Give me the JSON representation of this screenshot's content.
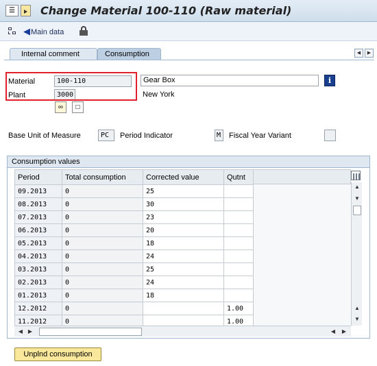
{
  "window": {
    "title": "Change Material 100-110 (Raw material)"
  },
  "toolbar": {
    "main_data_label": "Main data"
  },
  "tabs": [
    {
      "label": "Internal comment",
      "active": false
    },
    {
      "label": "Consumption",
      "active": true
    }
  ],
  "header": {
    "material_label": "Material",
    "material_value": "100-110",
    "material_desc": "Gear Box",
    "plant_label": "Plant",
    "plant_value": "3000",
    "plant_desc": "New York"
  },
  "units": {
    "base_uom_label": "Base Unit of Measure",
    "base_uom_value": "PC",
    "period_indicator_label": "Period Indicator",
    "period_indicator_value": "M",
    "fiscal_year_variant_label": "Fiscal Year Variant",
    "fiscal_year_variant_value": ""
  },
  "consumption": {
    "group_title": "Consumption values",
    "columns": [
      "Period",
      "Total consumption",
      "Corrected value",
      "Qutnt"
    ],
    "rows": [
      [
        "09.2013",
        "0",
        "25",
        ""
      ],
      [
        "08.2013",
        "0",
        "30",
        ""
      ],
      [
        "07.2013",
        "0",
        "23",
        ""
      ],
      [
        "06.2013",
        "0",
        "20",
        ""
      ],
      [
        "05.2013",
        "0",
        "18",
        ""
      ],
      [
        "04.2013",
        "0",
        "24",
        ""
      ],
      [
        "03.2013",
        "0",
        "25",
        ""
      ],
      [
        "02.2013",
        "0",
        "24",
        ""
      ],
      [
        "01.2013",
        "0",
        "18",
        ""
      ],
      [
        "12.2012",
        "0",
        "",
        "1.00"
      ],
      [
        "11.2012",
        "0",
        "",
        "1.00"
      ]
    ]
  },
  "actions": {
    "unplanned_label": "Unplnd consumption"
  }
}
